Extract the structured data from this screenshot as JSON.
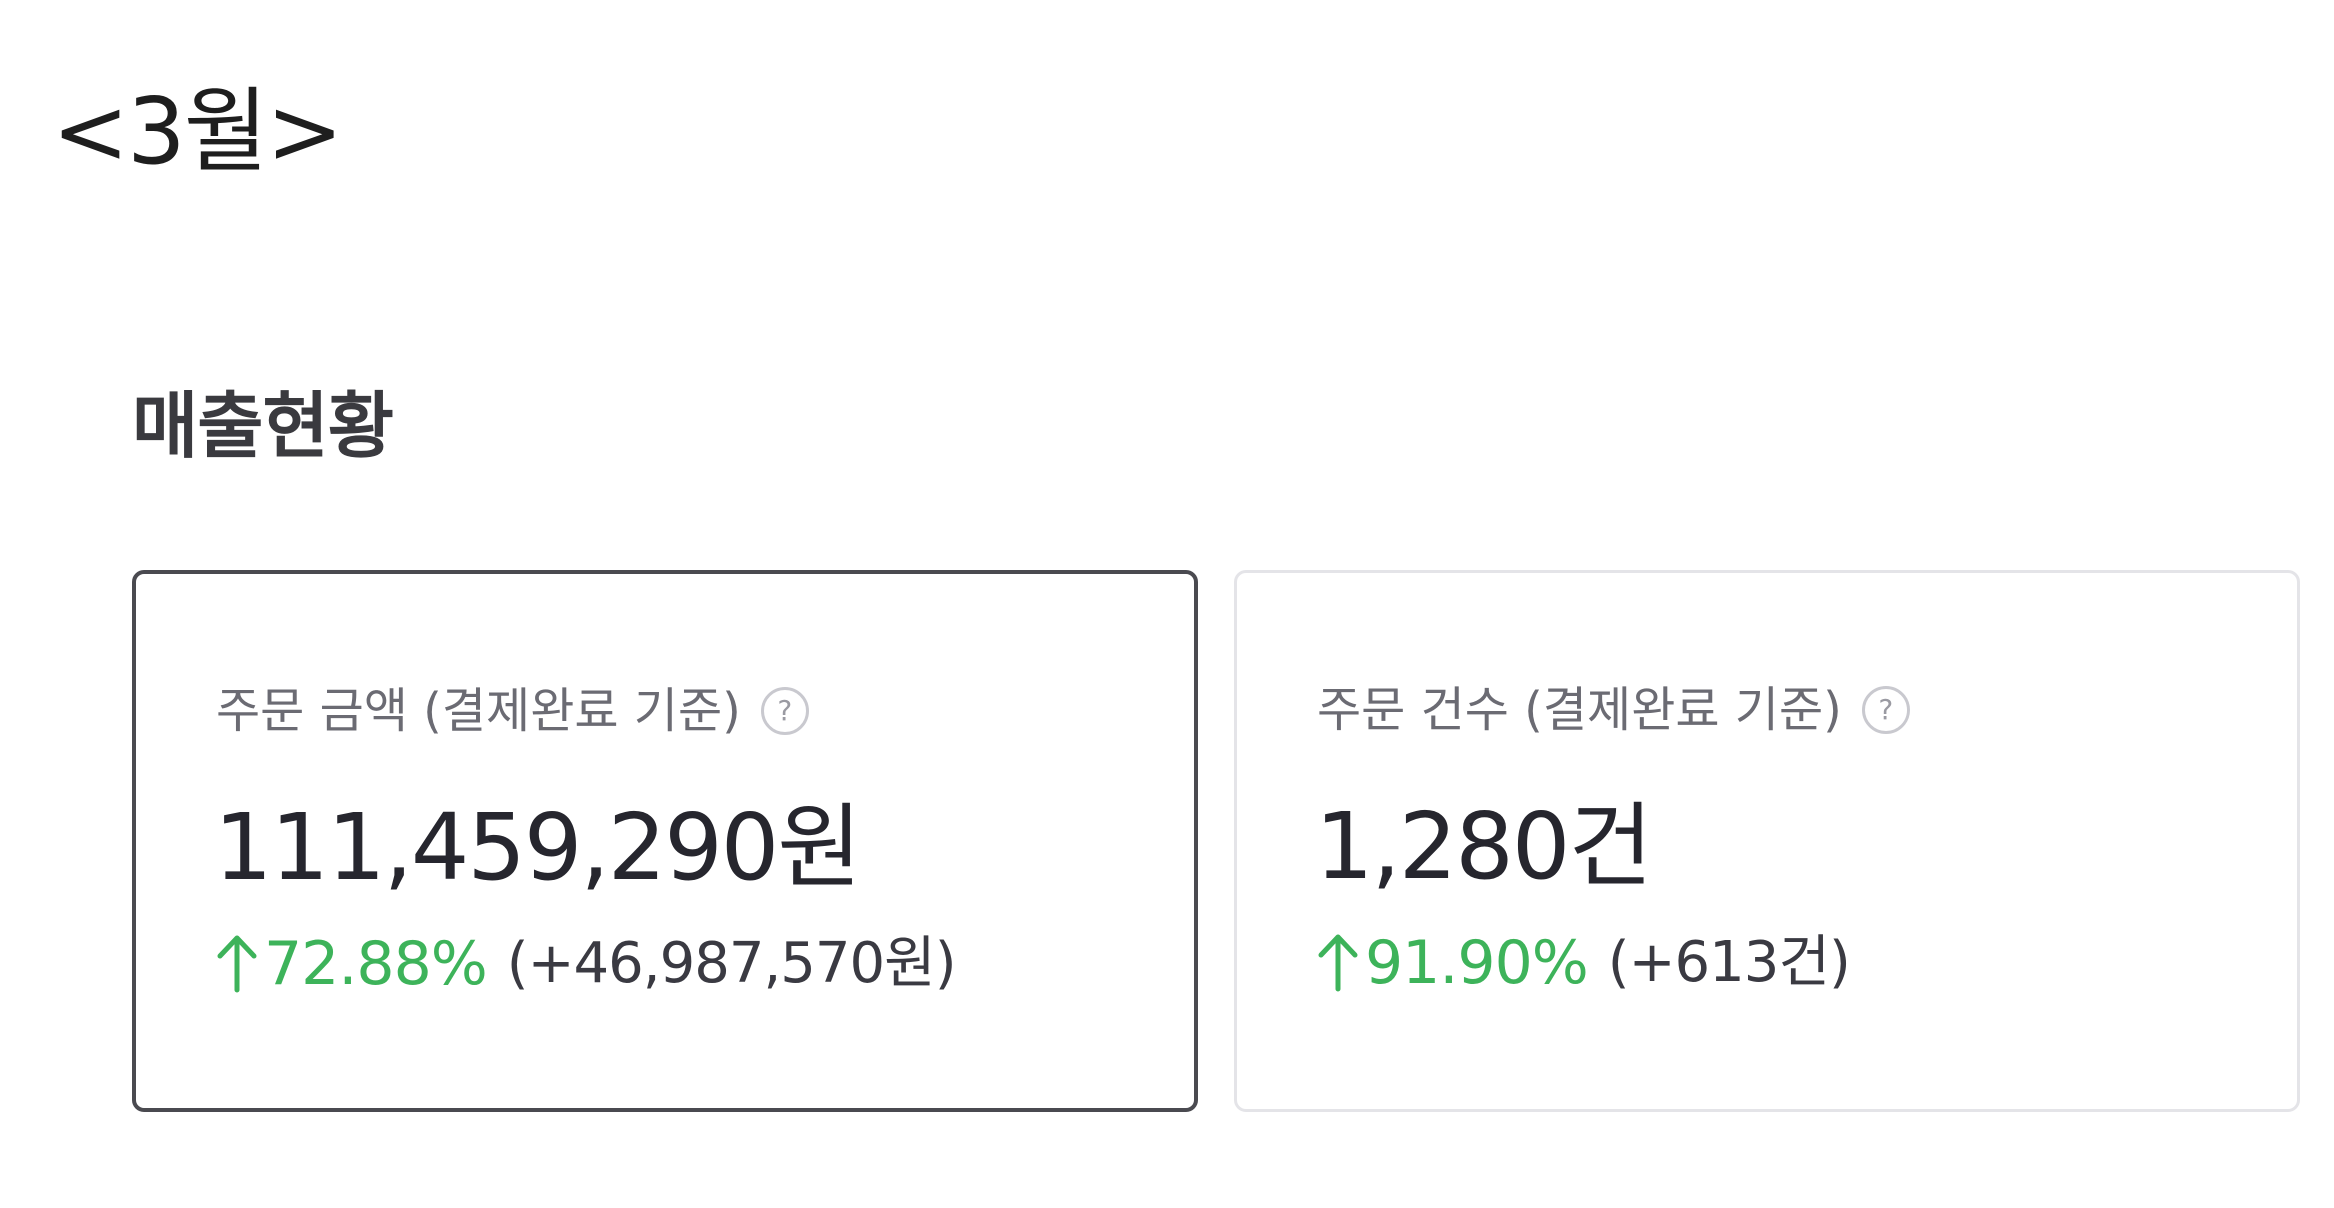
{
  "header": {
    "month": "<3월>"
  },
  "section": {
    "title": "매출현황"
  },
  "cards": [
    {
      "label": "주문 금액 (결제완료 기준)",
      "help": "?",
      "value": "111,459,290원",
      "change_percent": "72.88%",
      "change_diff": "(+46,987,570원)",
      "trend": "up",
      "selected": true
    },
    {
      "label": "주문 건수 (결제완료 기준)",
      "help": "?",
      "value": "1,280건",
      "change_percent": "91.90%",
      "change_diff": "(+613건)",
      "trend": "up",
      "selected": false
    }
  ],
  "colors": {
    "positive": "#3db35a",
    "selected_border": "#4a4a50",
    "card_border": "#e4e4e8"
  },
  "icons": {
    "help": "question-circle-icon",
    "trend_up": "arrow-up-icon"
  }
}
